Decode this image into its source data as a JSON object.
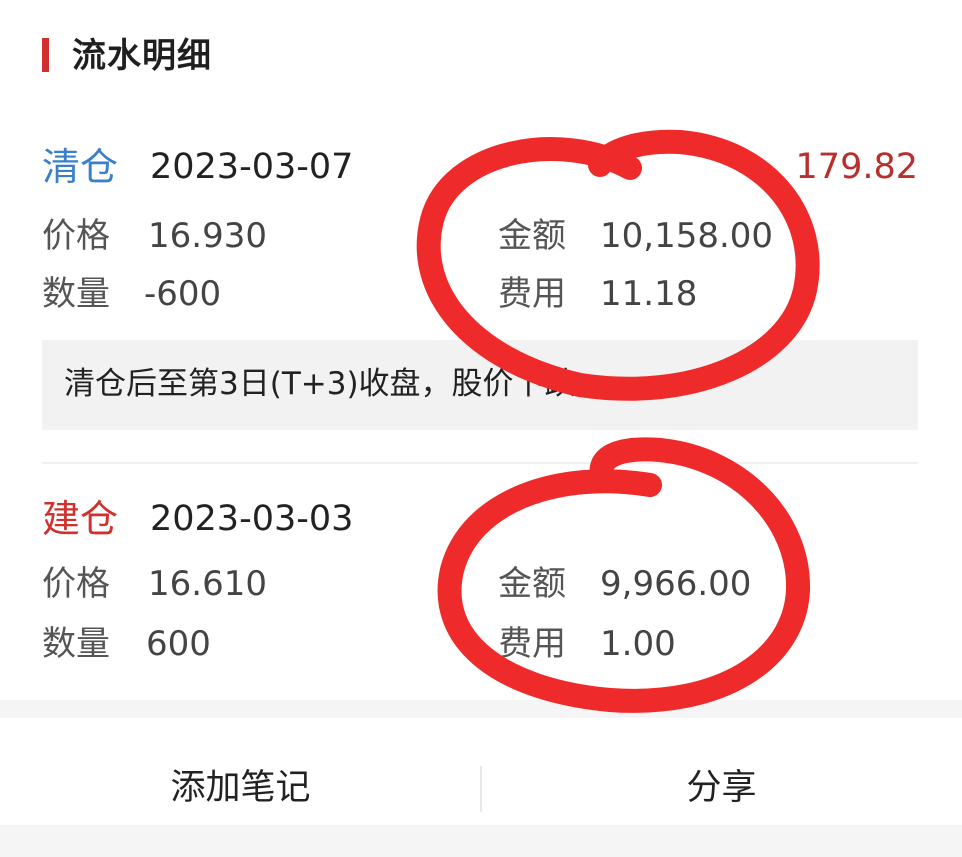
{
  "header": {
    "title": "流水明细"
  },
  "records": [
    {
      "type": "清仓",
      "date": "2023-03-07",
      "profit": "179.82",
      "price_label": "价格",
      "price": "16.930",
      "qty_label": "数量",
      "qty": "-600",
      "amount_label": "金额",
      "amount": "10,158.00",
      "fee_label": "费用",
      "fee": "11.18",
      "note": "清仓后至第3日(T+3)收盘，股价下跌"
    },
    {
      "type": "建仓",
      "date": "2023-03-03",
      "price_label": "价格",
      "price": "16.610",
      "qty_label": "数量",
      "qty": "600",
      "amount_label": "金额",
      "amount": "9,966.00",
      "fee_label": "费用",
      "fee": "1.00"
    }
  ],
  "bottom": {
    "add_note": "添加笔记",
    "share": "分享"
  },
  "colors": {
    "accent": "#d0312d",
    "sell": "#3a80c9",
    "buy": "#d0312d",
    "annotation": "#ee2a2a"
  }
}
